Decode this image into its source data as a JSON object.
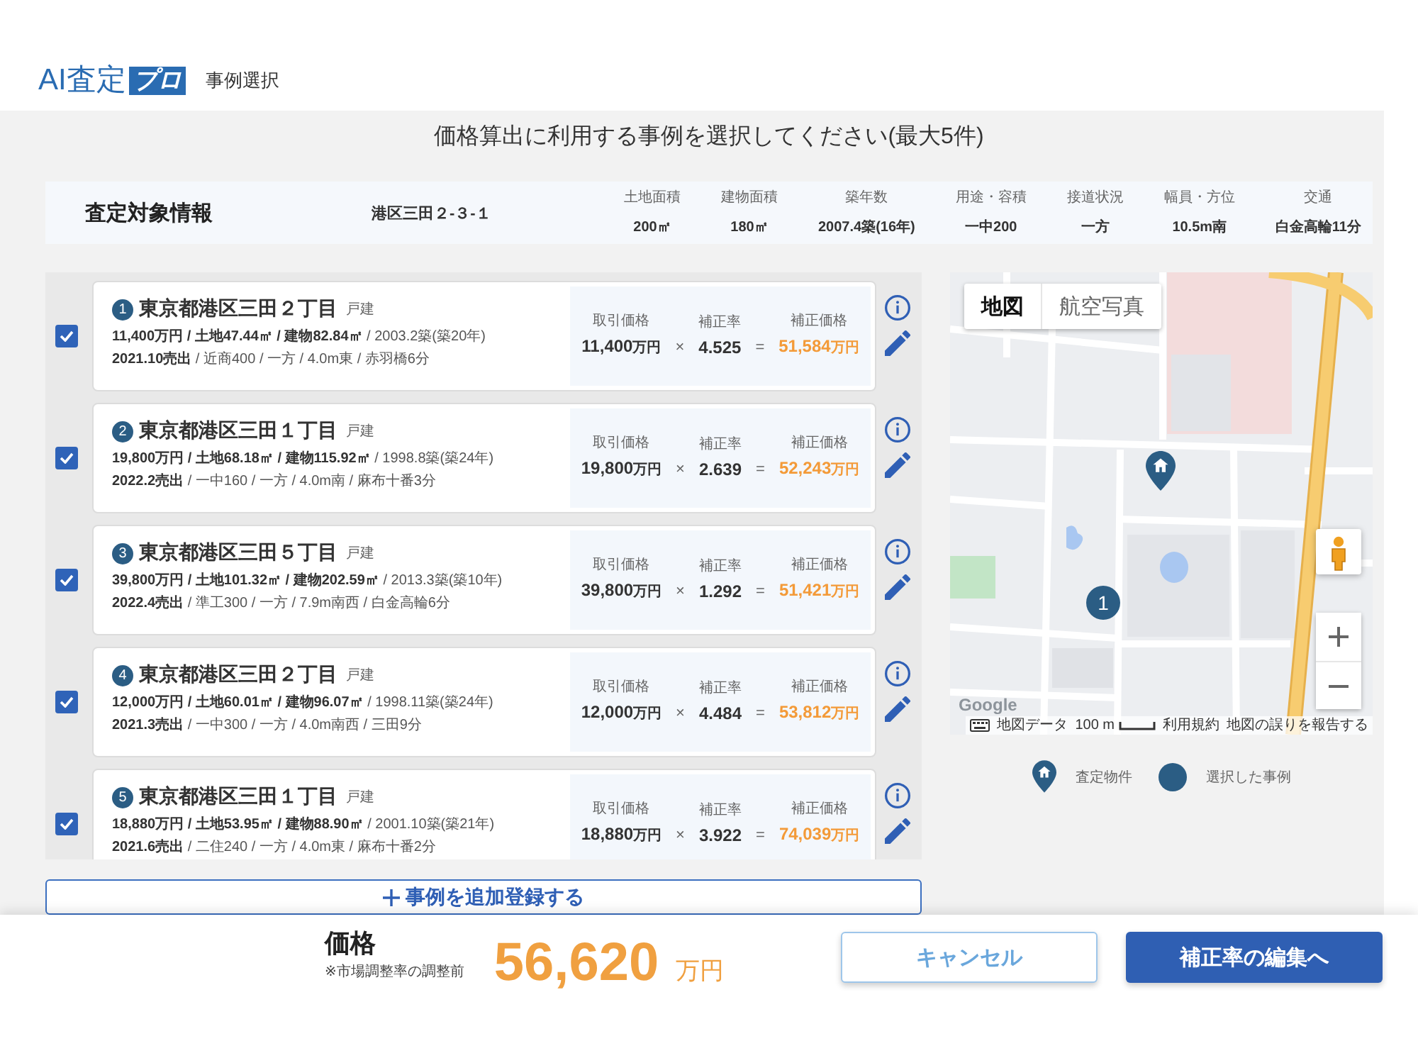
{
  "header": {
    "logo_text": "AI査定",
    "logo_badge": "プロ",
    "page_title": "事例選択"
  },
  "instruction": "価格算出に利用する事例を選択してください(最大5件)",
  "subject": {
    "heading": "査定対象情報",
    "address": "港区三田２-３-１",
    "fields": [
      {
        "label": "土地面積",
        "value": "200㎡"
      },
      {
        "label": "建物面積",
        "value": "180㎡"
      },
      {
        "label": "築年数",
        "value": "2007.4築(16年)"
      },
      {
        "label": "用途・容積",
        "value": "一中200"
      },
      {
        "label": "接道状況",
        "value": "一方"
      },
      {
        "label": "幅員・方位",
        "value": "10.5m南"
      },
      {
        "label": "交通",
        "value": "白金高輪11分"
      }
    ]
  },
  "cases": [
    {
      "number": "1",
      "checked": true,
      "address": "東京都港区三田２丁目",
      "type": "戸建",
      "details": "**11,400万円 / 土地47.44㎡ / 建物82.84㎡** / 2003.2築(築20年)",
      "sale": "**2021.10売出** / 近商400 / 一方 / 4.0m東 / 赤羽橋6分",
      "trade_price_label": "取引価格",
      "trade_price": "11,400",
      "trade_price_unit": "万円",
      "times": "×",
      "rate_label": "補正率",
      "rate": "4.525",
      "equals": "=",
      "adjusted_price_label": "補正価格",
      "adjusted_price": "51,584",
      "adjusted_price_unit": "万円"
    },
    {
      "number": "2",
      "checked": true,
      "address": "東京都港区三田１丁目",
      "type": "戸建",
      "details": "**19,800万円 / 土地68.18㎡ / 建物115.92㎡** / 1998.8築(築24年)",
      "sale": "**2022.2売出** / 一中160 / 一方 / 4.0m南 / 麻布十番3分",
      "trade_price_label": "取引価格",
      "trade_price": "19,800",
      "trade_price_unit": "万円",
      "times": "×",
      "rate_label": "補正率",
      "rate": "2.639",
      "equals": "=",
      "adjusted_price_label": "補正価格",
      "adjusted_price": "52,243",
      "adjusted_price_unit": "万円"
    },
    {
      "number": "3",
      "checked": true,
      "address": "東京都港区三田５丁目",
      "type": "戸建",
      "details": "**39,800万円 / 土地101.32㎡ / 建物202.59㎡** / 2013.3築(築10年)",
      "sale": "**2022.4売出** / 準工300 / 一方 / 7.9m南西 / 白金高輪6分",
      "trade_price_label": "取引価格",
      "trade_price": "39,800",
      "trade_price_unit": "万円",
      "times": "×",
      "rate_label": "補正率",
      "rate": "1.292",
      "equals": "=",
      "adjusted_price_label": "補正価格",
      "adjusted_price": "51,421",
      "adjusted_price_unit": "万円"
    },
    {
      "number": "4",
      "checked": true,
      "address": "東京都港区三田２丁目",
      "type": "戸建",
      "details": "**12,000万円 / 土地60.01㎡ / 建物96.07㎡** / 1998.11築(築24年)",
      "sale": "**2021.3売出** / 一中300 / 一方 / 4.0m南西 / 三田9分",
      "trade_price_label": "取引価格",
      "trade_price": "12,000",
      "trade_price_unit": "万円",
      "times": "×",
      "rate_label": "補正率",
      "rate": "4.484",
      "equals": "=",
      "adjusted_price_label": "補正価格",
      "adjusted_price": "53,812",
      "adjusted_price_unit": "万円"
    },
    {
      "number": "5",
      "checked": true,
      "address": "東京都港区三田１丁目",
      "type": "戸建",
      "details": "**18,880万円 / 土地53.95㎡ / 建物88.90㎡** / 2001.10築(築21年)",
      "sale": "**2021.6売出** / 二住240 / 一方 / 4.0m東 / 麻布十番2分",
      "trade_price_label": "取引価格",
      "trade_price": "18,880",
      "trade_price_unit": "万円",
      "times": "×",
      "rate_label": "補正率",
      "rate": "3.922",
      "equals": "=",
      "adjusted_price_label": "補正価格",
      "adjusted_price": "74,039",
      "adjusted_price_unit": "万円"
    }
  ],
  "add_case_button": "事例を追加登録する",
  "map": {
    "map_types": [
      {
        "label": "地図",
        "selected": true
      },
      {
        "label": "航空写真",
        "selected": false
      }
    ],
    "cluster_marker": "1",
    "attribution": {
      "logo": "Google",
      "data": "地図データ",
      "scale": "100 m",
      "terms": "利用規約",
      "report": "地図の誤りを報告する"
    }
  },
  "legend": [
    {
      "kind": "subject",
      "label": "査定物件"
    },
    {
      "kind": "case",
      "label": "選択した事例"
    }
  ],
  "price": {
    "label": "価格",
    "note": "※市場調整率の調整前",
    "value": "56,620",
    "unit": "万円"
  },
  "buttons": [
    {
      "kind": "secondary",
      "label": "キャンセル"
    },
    {
      "kind": "primary",
      "label": "補正率の編集へ"
    }
  ]
}
